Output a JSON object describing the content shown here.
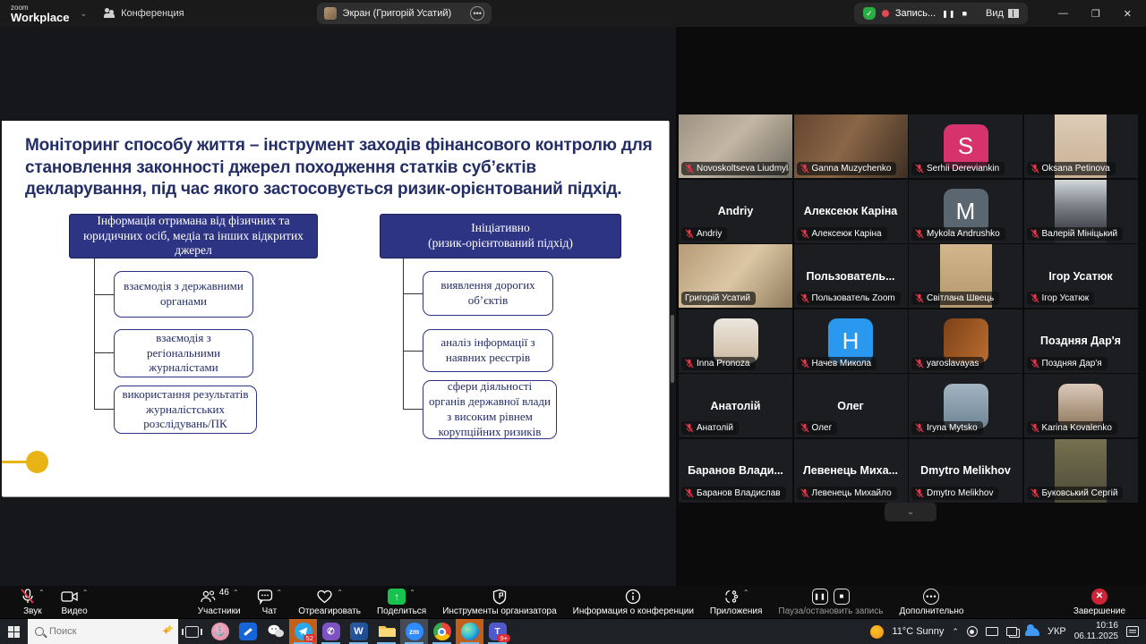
{
  "titlebar": {
    "logo_line1": "zoom",
    "logo_line2": "Workplace",
    "meeting_tab": "Конференция",
    "screen_tab": "Экран (Григорій Усатий)",
    "recording_label": "Запись...",
    "view_label": "Вид"
  },
  "slide": {
    "title": "Моніторинг способу життя – інструмент заходів фінансового контролю для становлення законності джерел походження статків суб’єктів декларування, під час якого застосовується ризик-орієнтований підхід.",
    "left": {
      "header": "Інформація отримана від фізичних та юридичних осіб, медіа та інших відкритих джерел",
      "items": [
        "взаємодія з державними органами",
        "взаємодія з регіональними журналістами",
        "використання результатів журналістських розслідувань/ПК"
      ]
    },
    "right": {
      "header_line1": "Ініціативно",
      "header_line2": "(ризик-орієнтований підхід)",
      "items": [
        "виявлення дорогих об’єктів",
        "аналіз інформації з наявних реєстрів",
        "сфери діяльності органів державної влади з високим рівнем корупційних ризиків"
      ]
    }
  },
  "gallery": {
    "participants": [
      {
        "label": "Novoskoltseva Liudmyla",
        "kind": "video",
        "style": "v1",
        "muted": true
      },
      {
        "label": "Ganna Muzychenko",
        "kind": "video",
        "style": "v2",
        "muted": true
      },
      {
        "label": "Serhii Dereviankin",
        "kind": "letter",
        "letter": "S",
        "color": "#d6336c",
        "muted": true
      },
      {
        "label": "Oksana Petinova",
        "kind": "portrait",
        "style": "v3",
        "muted": true
      },
      {
        "label": "Andriy",
        "kind": "name",
        "center": "Andriy",
        "muted": true
      },
      {
        "label": "Алексеюк Каріна",
        "kind": "name",
        "center": "Алексеюк Каріна",
        "muted": true
      },
      {
        "label": "Mykola Andrushko",
        "kind": "letter",
        "letter": "M",
        "color": "#5b6770",
        "muted": true
      },
      {
        "label": "Валерій Мініцький",
        "kind": "portrait",
        "style": "v4",
        "muted": true
      },
      {
        "label": "Григорій Усатий",
        "kind": "video",
        "style": "v5",
        "muted": false,
        "active": true
      },
      {
        "label": "Пользователь Zoom",
        "kind": "name",
        "center": "Пользователь...",
        "muted": true
      },
      {
        "label": "Світлана Швець",
        "kind": "portrait",
        "style": "v6",
        "muted": true
      },
      {
        "label": "Ігор Усатюк",
        "kind": "name",
        "center": "Ігор Усатюк",
        "muted": true
      },
      {
        "label": "Inna Pronoza",
        "kind": "photo",
        "style": "p1",
        "muted": true
      },
      {
        "label": "Начев Микола",
        "kind": "letter",
        "letter": "H",
        "color": "#2b98f0",
        "muted": true
      },
      {
        "label": "yaroslavayas",
        "kind": "photo",
        "style": "p2",
        "muted": true
      },
      {
        "label": "Поздняя Дар'я",
        "kind": "name",
        "center": "Поздняя Дар'я",
        "muted": true
      },
      {
        "label": "Анатолій",
        "kind": "name",
        "center": "Анатолій",
        "muted": true
      },
      {
        "label": "Олег",
        "kind": "name",
        "center": "Олег",
        "muted": true
      },
      {
        "label": "Iryna Mytsko",
        "kind": "photo",
        "style": "p3",
        "muted": true
      },
      {
        "label": "Karina Kovalenko",
        "kind": "photo",
        "style": "p4",
        "muted": true
      },
      {
        "label": "Баранов Владислав",
        "kind": "name",
        "center": "Баранов Влади...",
        "muted": true
      },
      {
        "label": "Левенець Михайло",
        "kind": "name",
        "center": "Левенець Миха...",
        "muted": true
      },
      {
        "label": "Dmytro Melikhov",
        "kind": "name",
        "center": "Dmytro Melikhov",
        "muted": true
      },
      {
        "label": "Буковський Сергій",
        "kind": "portrait",
        "style": "v7",
        "muted": true
      }
    ]
  },
  "toolbar": {
    "audio": "Звук",
    "video": "Видео",
    "participants": "Участники",
    "participants_count": "46",
    "chat": "Чат",
    "react": "Отреагировать",
    "share": "Поделиться",
    "host_tools": "Инструменты организатора",
    "meeting_info": "Информация о конференции",
    "apps": "Приложения",
    "record_pause": "Пауза/остановить запись",
    "more": "Дополнительно",
    "end": "Завершение"
  },
  "taskbar": {
    "search_placeholder": "Поиск",
    "telegram_badge": "52",
    "teams_badge": "9+",
    "weather": "11°C Sunny",
    "lang": "УКР",
    "time": "10:16",
    "date": "06.11.2025"
  }
}
